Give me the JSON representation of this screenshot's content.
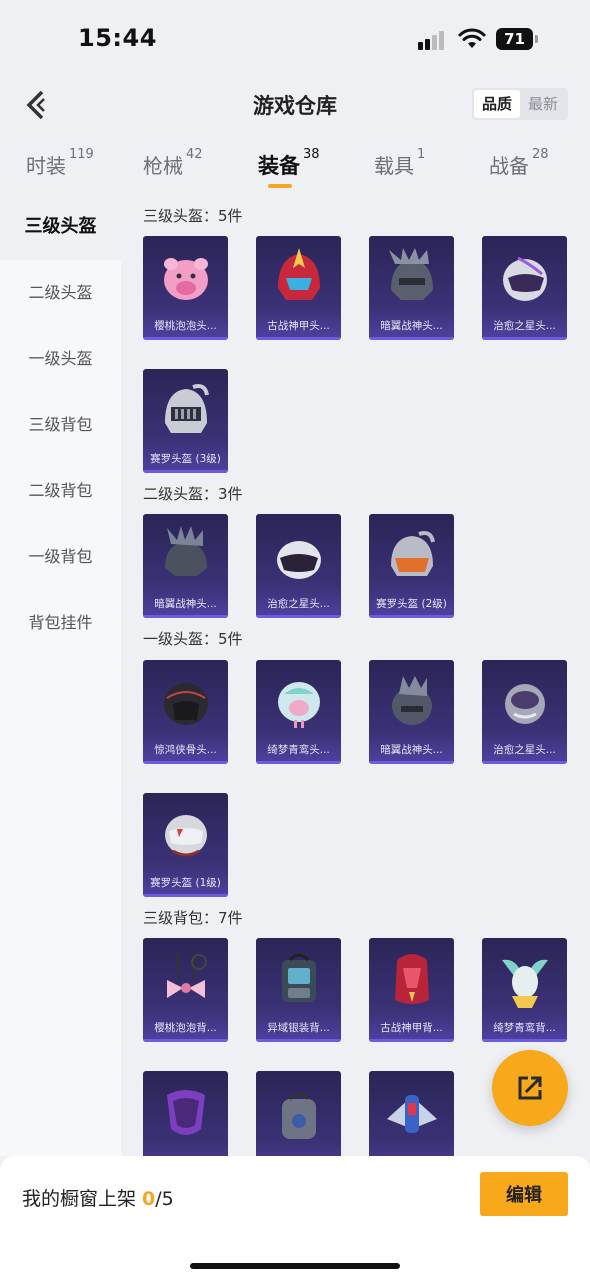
{
  "status": {
    "time": "15:44",
    "battery": "71"
  },
  "nav": {
    "title": "游戏仓库",
    "sort_quality": "品质",
    "sort_newest": "最新"
  },
  "tabs": [
    {
      "label": "时装",
      "count": "119"
    },
    {
      "label": "枪械",
      "count": "42"
    },
    {
      "label": "装备",
      "count": "38"
    },
    {
      "label": "载具",
      "count": "1"
    },
    {
      "label": "战备",
      "count": "28"
    }
  ],
  "sidebar": [
    "三级头盔",
    "二级头盔",
    "一级头盔",
    "三级背包",
    "二级背包",
    "一级背包",
    "背包挂件"
  ],
  "sections": [
    {
      "title": "三级头盔：5件",
      "items": [
        "樱桃泡泡头...",
        "古战神甲头...",
        "暗翼战神头...",
        "治愈之星头...",
        "赛罗头盔 (3级)"
      ]
    },
    {
      "title": "二级头盔：3件",
      "items": [
        "暗翼战神头...",
        "治愈之星头...",
        "赛罗头盔 (2级)"
      ]
    },
    {
      "title": "一级头盔：5件",
      "items": [
        "惊鸿侠骨头...",
        "绮梦青鸾头...",
        "暗翼战神头...",
        "治愈之星头...",
        "赛罗头盔 (1级)"
      ]
    },
    {
      "title": "三级背包：7件",
      "items": [
        "樱桃泡泡背...",
        "异域银装背...",
        "古战神甲背...",
        "绮梦青鸾背...",
        "",
        "",
        ""
      ]
    }
  ],
  "bottom": {
    "label": "我的橱窗上架 ",
    "count": "0",
    "total": "/5",
    "edit": "编辑"
  },
  "colors": {
    "accent": "#f7a81b",
    "card_bg": "#3b3277"
  }
}
